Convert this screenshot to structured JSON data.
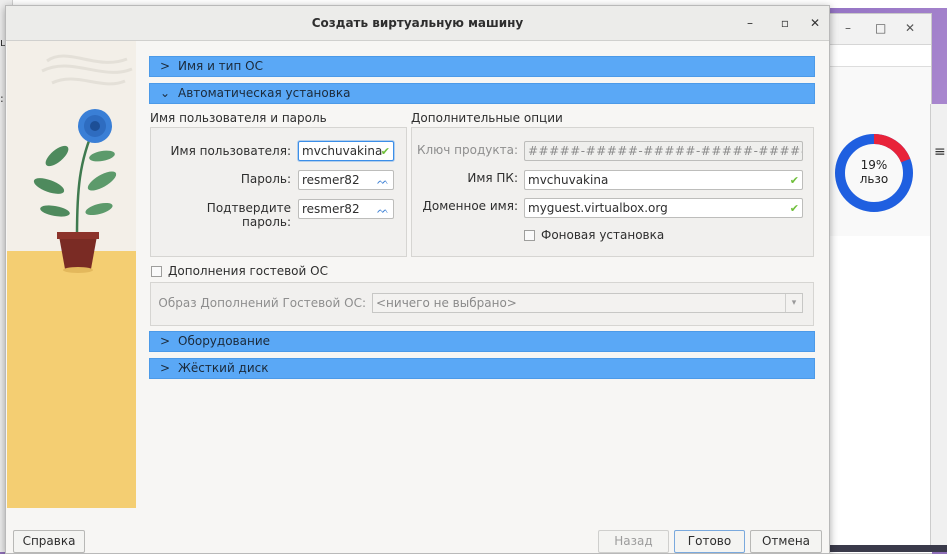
{
  "dialog": {
    "title": "Создать виртуальную машину",
    "minimize_icon": "minimize-icon",
    "maximize_icon": "maximize-icon",
    "close_icon": "close-icon"
  },
  "sections": {
    "name_os": "Имя и тип ОС",
    "unattended": "Автоматическая установка",
    "hardware": "Оборудование",
    "disk": "Жёсткий диск"
  },
  "user_group": {
    "title": "Имя пользователя и пароль",
    "username_label": "Имя пользователя:",
    "username_value": "mvchuvakina",
    "password_label": "Пароль:",
    "password_value": "resmer82",
    "confirm_label": "Подтвердите пароль:",
    "confirm_value": "resmer82"
  },
  "options_group": {
    "title": "Дополнительные опции",
    "product_key_label": "Ключ продукта:",
    "product_key_placeholder": "#####-#####-#####-#####-#####",
    "hostname_label": "Имя ПК:",
    "hostname_value": "mvchuvakina",
    "domain_label": "Доменное имя:",
    "domain_value": "myguest.virtualbox.org",
    "background_install_label": "Фоновая установка"
  },
  "guest_additions": {
    "checkbox_label": "Дополнения гостевой ОС",
    "iso_label": "Образ Дополнений Гостевой ОС:",
    "iso_value": "<ничего не выбрано>"
  },
  "buttons": {
    "help": "Справка",
    "back": "Назад",
    "finish": "Готово",
    "cancel": "Отмена"
  },
  "background_window": {
    "donut_percent": "19%",
    "donut_caption": "льзо",
    "menu_icon": "≡",
    "colors": {
      "used": "#e8233a",
      "free": "#1f5fe0"
    }
  },
  "colors": {
    "section_bar": "#5aa8f6",
    "valid_check": "#6fbf3a"
  }
}
